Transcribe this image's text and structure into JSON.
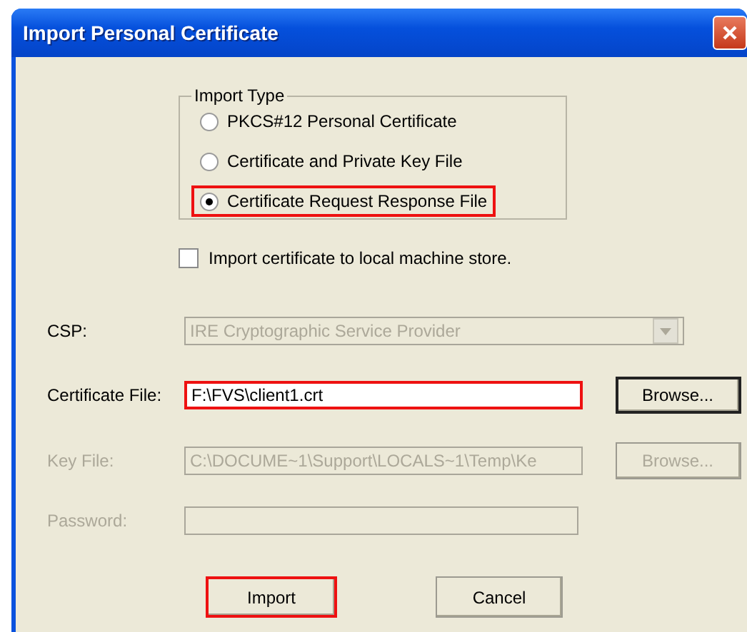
{
  "window": {
    "title": "Import Personal Certificate"
  },
  "import_type": {
    "label": "Import Type",
    "options": [
      {
        "label": "PKCS#12 Personal Certificate",
        "selected": false,
        "highlighted": false
      },
      {
        "label": "Certificate and Private Key File",
        "selected": false,
        "highlighted": false
      },
      {
        "label": "Certificate Request Response File",
        "selected": true,
        "highlighted": true
      }
    ]
  },
  "local_store": {
    "label": "Import certificate to local machine store.",
    "checked": false
  },
  "fields": [
    {
      "kind": "combo",
      "label": "CSP:",
      "value": "IRE Cryptographic Service Provider",
      "disabled": true,
      "highlighted": false
    },
    {
      "kind": "file",
      "label": "Certificate File:",
      "value": "F:\\FVS\\client1.crt",
      "disabled": false,
      "highlighted": true,
      "button": "Browse..."
    },
    {
      "kind": "file",
      "label": "Key File:",
      "value": "C:\\DOCUME~1\\Support\\LOCALS~1\\Temp\\Ke",
      "disabled": true,
      "highlighted": false,
      "button": "Browse..."
    },
    {
      "kind": "text",
      "label": "Password:",
      "disabled": true,
      "highlighted": false
    }
  ],
  "buttons": [
    {
      "label": "Import",
      "highlighted": true
    },
    {
      "label": "Cancel",
      "highlighted": false
    }
  ]
}
